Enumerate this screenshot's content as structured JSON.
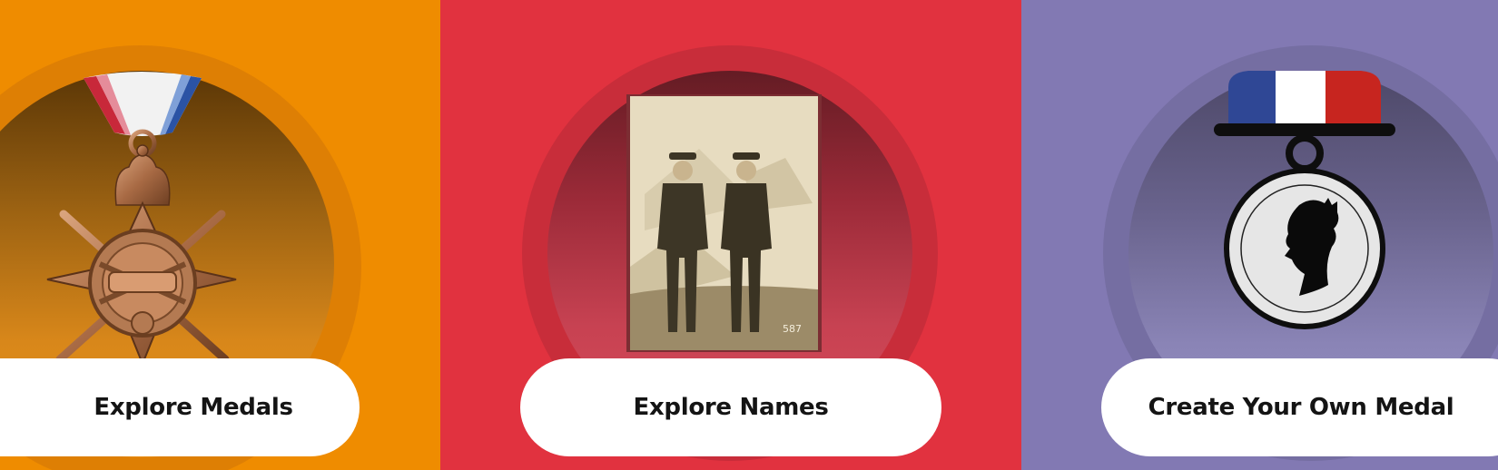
{
  "cards": {
    "medals": {
      "label": "Explore Medals",
      "background": "#ef8c00"
    },
    "names": {
      "label": "Explore Names",
      "background": "#e1323f",
      "photo_number": "587"
    },
    "create": {
      "label": "Create Your Own Medal",
      "background": "#8279b3"
    }
  },
  "icons": [
    "medal-star-image",
    "soldiers-photo",
    "medal-builder-icon",
    "queen-silhouette-icon"
  ]
}
